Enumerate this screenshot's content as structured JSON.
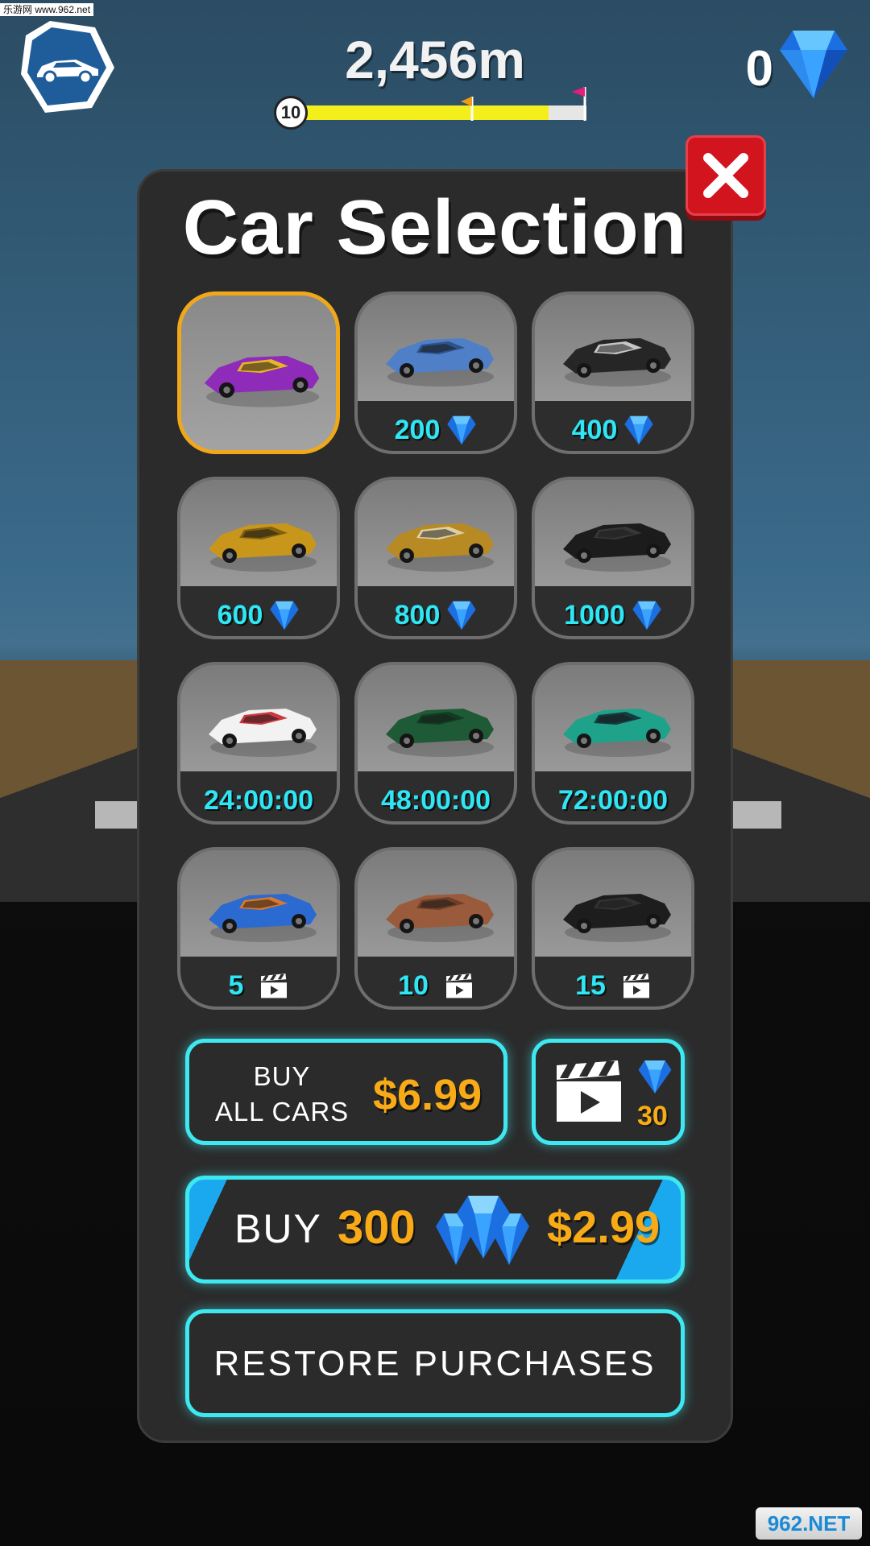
{
  "watermark": {
    "top": "乐游网 www.962.net",
    "bottom": "962.NET"
  },
  "hud": {
    "distance": "2,456m",
    "level": "10",
    "progress_fraction": 0.87,
    "gems": "0"
  },
  "panel": {
    "title": "Car Selection",
    "cars": [
      {
        "name": "purple-sports-car",
        "price": "",
        "currency": "none",
        "selected": true,
        "colors": [
          "#8e2bb8",
          "#f2c318"
        ]
      },
      {
        "name": "blue-supercar",
        "price": "200",
        "currency": "gem",
        "selected": false,
        "colors": [
          "#4f7fc6",
          "#2a4e83"
        ]
      },
      {
        "name": "black-mini",
        "price": "400",
        "currency": "gem",
        "selected": false,
        "colors": [
          "#262626",
          "#d8d8d8"
        ]
      },
      {
        "name": "gold-sports-car",
        "price": "600",
        "currency": "gem",
        "selected": false,
        "colors": [
          "#c9961c",
          "#7a5a10"
        ]
      },
      {
        "name": "gold-jeep",
        "price": "800",
        "currency": "gem",
        "selected": false,
        "colors": [
          "#b88a23",
          "#e2d7b0"
        ]
      },
      {
        "name": "police-car",
        "price": "1000",
        "currency": "gem",
        "selected": false,
        "colors": [
          "#1c1c1c",
          "#3b3b3b"
        ]
      },
      {
        "name": "formula-car",
        "price": "24:00:00",
        "currency": "time",
        "selected": false,
        "colors": [
          "#f2f2f2",
          "#c8232c"
        ]
      },
      {
        "name": "green-roadster",
        "price": "48:00:00",
        "currency": "time",
        "selected": false,
        "colors": [
          "#1d5a35",
          "#0f3a21"
        ]
      },
      {
        "name": "teal-race-car",
        "price": "72:00:00",
        "currency": "time",
        "selected": false,
        "colors": [
          "#1fa28a",
          "#15303a"
        ]
      },
      {
        "name": "monster-truck",
        "price": "5",
        "currency": "video",
        "selected": false,
        "colors": [
          "#2b6ad1",
          "#f07a17"
        ]
      },
      {
        "name": "hot-rod",
        "price": "10",
        "currency": "video",
        "selected": false,
        "colors": [
          "#9a5a3c",
          "#6d3c26"
        ]
      },
      {
        "name": "black-muscle-car",
        "price": "15",
        "currency": "video",
        "selected": false,
        "colors": [
          "#1d1d1d",
          "#353535"
        ]
      }
    ]
  },
  "buy_all": {
    "line1": "BUY",
    "line2": "ALL CARS",
    "price": "$6.99"
  },
  "video_gems": {
    "amount": "30",
    "icon": "clapperboard-icon"
  },
  "buy_gems": {
    "label": "BUY",
    "amount": "300",
    "price": "$2.99",
    "icon": "gem-cluster-icon"
  },
  "restore": {
    "label": "RESTORE PURCHASES"
  },
  "colors": {
    "accent": "#3ee8f0",
    "price_orange": "#f8ab17",
    "close_red": "#d2141f",
    "progress": "#f5ee1d"
  }
}
